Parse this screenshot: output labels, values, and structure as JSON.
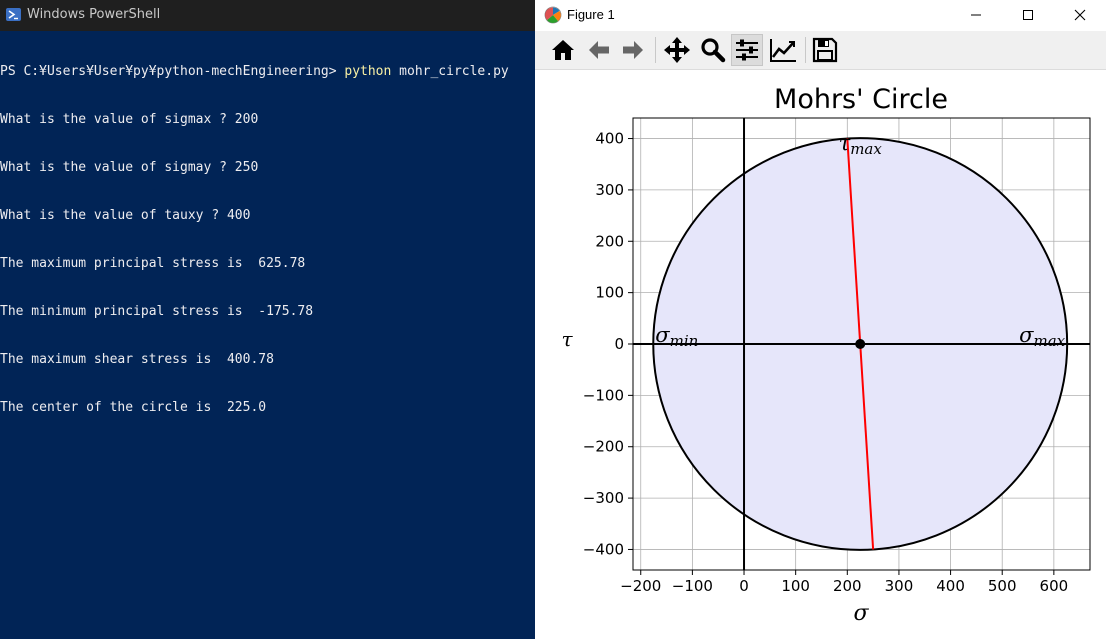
{
  "powershell": {
    "title": "Windows PowerShell",
    "prompt": "PS C:¥Users¥User¥py¥python-mechEngineering> ",
    "command": "python",
    "command_arg": " mohr_circle.py",
    "lines": [
      "What is the value of sigmax ? 200",
      "What is the value of sigmay ? 250",
      "What is the value of tauxy ? 400",
      "The maximum principal stress is  625.78",
      "The minimum principal stress is  -175.78",
      "The maximum shear stress is  400.78",
      "The center of the circle is  225.0"
    ]
  },
  "figure": {
    "window_title": "Figure 1",
    "toolbar": [
      "home-icon",
      "back-arrow-icon",
      "forward-arrow-icon",
      "pan-move-icon",
      "zoom-magnifier-icon",
      "configure-subplots-icon",
      "edit-axis-icon",
      "save-floppy-icon"
    ],
    "active_tool": "configure-subplots-icon"
  },
  "chart_data": {
    "type": "line",
    "title": "Mohrs' Circle",
    "xlabel": "σ",
    "ylabel": "τ",
    "xlim": [
      -215,
      670
    ],
    "ylim": [
      -440,
      440
    ],
    "xticks": [
      -200,
      -100,
      0,
      100,
      200,
      300,
      400,
      500,
      600
    ],
    "yticks": [
      -400,
      -300,
      -200,
      -100,
      0,
      100,
      200,
      300,
      400
    ],
    "xtick_labels": [
      "−200",
      "−100",
      "0",
      "100",
      "200",
      "300",
      "400",
      "500",
      "600"
    ],
    "ytick_labels": [
      "−400",
      "−300",
      "−200",
      "−100",
      "0",
      "100",
      "200",
      "300",
      "400"
    ],
    "grid": true,
    "circle": {
      "center_x": 225.0,
      "center_y": 0,
      "radius": 400.78,
      "fill_color": "#e6e6fa",
      "edge_color": "#000000"
    },
    "diameter_line": {
      "x": [
        200,
        250
      ],
      "y": [
        400,
        -400
      ],
      "color": "#ff0000"
    },
    "center_point": {
      "x": 225.0,
      "y": 0
    },
    "annotations": [
      {
        "text": "σ",
        "sub": "max",
        "x": 625.78,
        "y": 0,
        "anchor": "end"
      },
      {
        "text": "σ",
        "sub": "min",
        "x": -175.78,
        "y": 0,
        "anchor": "start"
      },
      {
        "text": "τ",
        "sub": "max",
        "x": 225,
        "y": 400.78,
        "anchor": "middle"
      }
    ]
  }
}
